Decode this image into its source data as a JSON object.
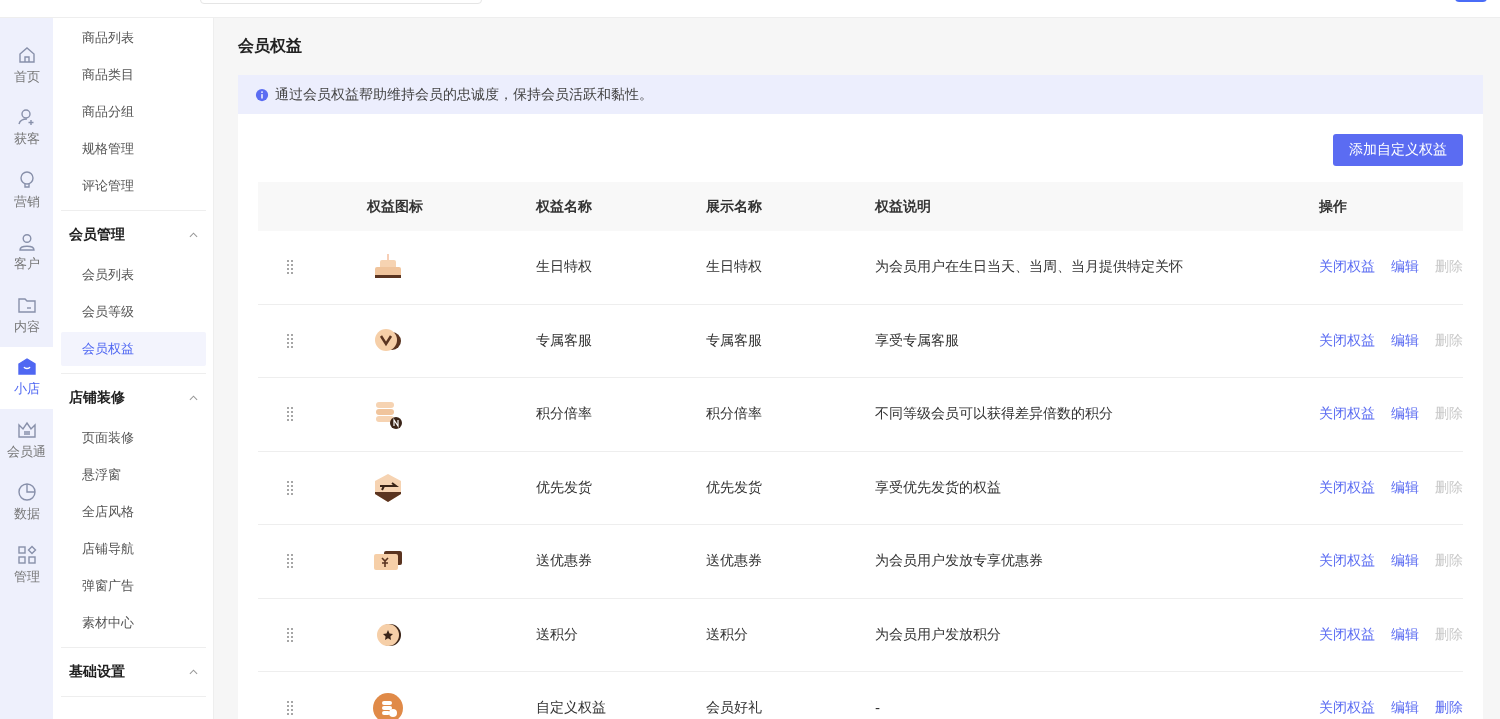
{
  "rail": [
    {
      "kind": "home",
      "label": "首页",
      "selected": false
    },
    {
      "kind": "user-plus",
      "label": "获客",
      "selected": false
    },
    {
      "kind": "bulb",
      "label": "营销",
      "selected": false
    },
    {
      "kind": "user",
      "label": "客户",
      "selected": false
    },
    {
      "kind": "folder",
      "label": "内容",
      "selected": false
    },
    {
      "kind": "shop",
      "label": "小店",
      "selected": true
    },
    {
      "kind": "crown",
      "label": "会员通",
      "selected": false
    },
    {
      "kind": "pie",
      "label": "数据",
      "selected": false
    },
    {
      "kind": "grid",
      "label": "管理",
      "selected": false
    }
  ],
  "subnav": [
    {
      "items": [
        {
          "label": "商品列表",
          "selected": false
        },
        {
          "label": "商品类目",
          "selected": false
        },
        {
          "label": "商品分组",
          "selected": false
        },
        {
          "label": "规格管理",
          "selected": false
        },
        {
          "label": "评论管理",
          "selected": false
        }
      ]
    },
    {
      "title": "会员管理",
      "expanded": true,
      "items": [
        {
          "label": "会员列表",
          "selected": false
        },
        {
          "label": "会员等级",
          "selected": false
        },
        {
          "label": "会员权益",
          "selected": true
        }
      ]
    },
    {
      "title": "店铺装修",
      "expanded": true,
      "items": [
        {
          "label": "页面装修",
          "selected": false
        },
        {
          "label": "悬浮窗",
          "selected": false
        },
        {
          "label": "全店风格",
          "selected": false
        },
        {
          "label": "店铺导航",
          "selected": false
        },
        {
          "label": "弹窗广告",
          "selected": false
        },
        {
          "label": "素材中心",
          "selected": false
        }
      ]
    },
    {
      "title": "基础设置",
      "expanded": true
    }
  ],
  "page_title": "会员权益",
  "notice": "通过会员权益帮助维持会员的忠诚度，保持会员活跃和黏性。",
  "add_button": "添加自定义权益",
  "table": {
    "columns": [
      "权益图标",
      "权益名称",
      "展示名称",
      "权益说明",
      "操作"
    ],
    "rows": [
      {
        "name": "生日特权",
        "display": "生日特权",
        "desc": "为会员用户在生日当天、当周、当月提供特定关怀",
        "actions": [
          {
            "label": "关闭权益",
            "disabled": false
          },
          {
            "label": "编辑",
            "disabled": false
          },
          {
            "label": "删除",
            "disabled": true
          }
        ]
      },
      {
        "name": "专属客服",
        "display": "专属客服",
        "desc": "享受专属客服",
        "actions": [
          {
            "label": "关闭权益",
            "disabled": false
          },
          {
            "label": "编辑",
            "disabled": false
          },
          {
            "label": "删除",
            "disabled": true
          }
        ]
      },
      {
        "name": "积分倍率",
        "display": "积分倍率",
        "desc": "不同等级会员可以获得差异倍数的积分",
        "actions": [
          {
            "label": "关闭权益",
            "disabled": false
          },
          {
            "label": "编辑",
            "disabled": false
          },
          {
            "label": "删除",
            "disabled": true
          }
        ]
      },
      {
        "name": "优先发货",
        "display": "优先发货",
        "desc": "享受优先发货的权益",
        "actions": [
          {
            "label": "关闭权益",
            "disabled": false
          },
          {
            "label": "编辑",
            "disabled": false
          },
          {
            "label": "删除",
            "disabled": true
          }
        ]
      },
      {
        "name": "送优惠券",
        "display": "送优惠券",
        "desc": "为会员用户发放专享优惠券",
        "actions": [
          {
            "label": "关闭权益",
            "disabled": false
          },
          {
            "label": "编辑",
            "disabled": false
          },
          {
            "label": "删除",
            "disabled": true
          }
        ]
      },
      {
        "name": "送积分",
        "display": "送积分",
        "desc": "为会员用户发放积分",
        "actions": [
          {
            "label": "关闭权益",
            "disabled": false
          },
          {
            "label": "编辑",
            "disabled": false
          },
          {
            "label": "删除",
            "disabled": true
          }
        ]
      },
      {
        "name": "自定义权益",
        "display": "会员好礼",
        "desc": "-",
        "actions": [
          {
            "label": "关闭权益",
            "disabled": false
          },
          {
            "label": "编辑",
            "disabled": false
          },
          {
            "label": "删除",
            "disabled": false
          }
        ]
      }
    ]
  }
}
